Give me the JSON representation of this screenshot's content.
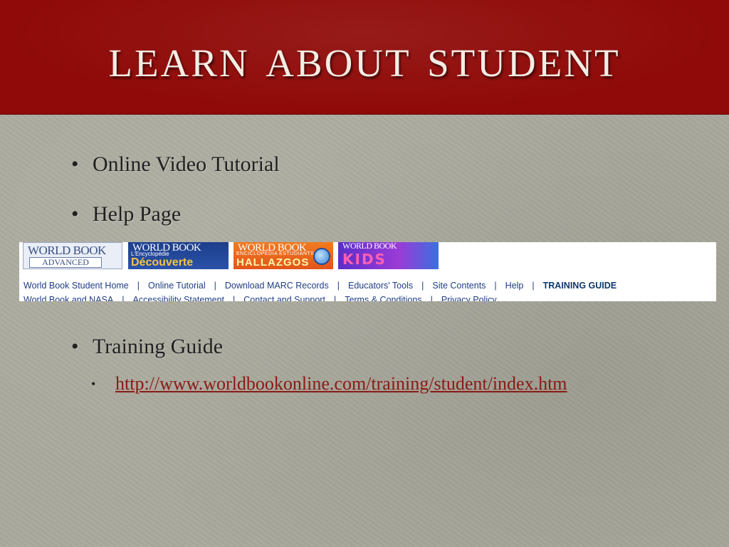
{
  "slide": {
    "title": "Learn About Student",
    "bullets": [
      {
        "marker": "•",
        "text": "Online Video Tutorial"
      },
      {
        "marker": "•",
        "text": "Help Page"
      },
      {
        "marker": "•",
        "text": "Training Guide"
      }
    ],
    "sub_bullet": {
      "marker": "•",
      "link": "http://www.worldbookonline.com/training/student/index.htm"
    }
  },
  "screenshot": {
    "logos": [
      {
        "brand": "WORLD BOOK",
        "label": "ADVANCED"
      },
      {
        "brand": "WORLD BOOK",
        "small": "L'Encyclopédie",
        "label": "Découverte"
      },
      {
        "brand": "WORLD BOOK",
        "small": "ENCICLOPEDIA ESTUDIANTIL",
        "label": "HALLAZGOS"
      },
      {
        "brand": "WORLD BOOK",
        "label": "KIDS"
      }
    ],
    "nav_row1": [
      "World Book Student Home",
      "Online Tutorial",
      "Download MARC Records",
      "Educators' Tools",
      "Site Contents",
      "Help",
      "TRAINING GUIDE"
    ],
    "nav_row2": [
      "World Book and NASA",
      "Accessibility Statement",
      "Contact and Support",
      "Terms & Conditions",
      "Privacy Policy"
    ],
    "separator": "|"
  },
  "colors": {
    "title_bar": "#8f0a08",
    "background": "#a9a99d",
    "link": "#8b1a14"
  }
}
